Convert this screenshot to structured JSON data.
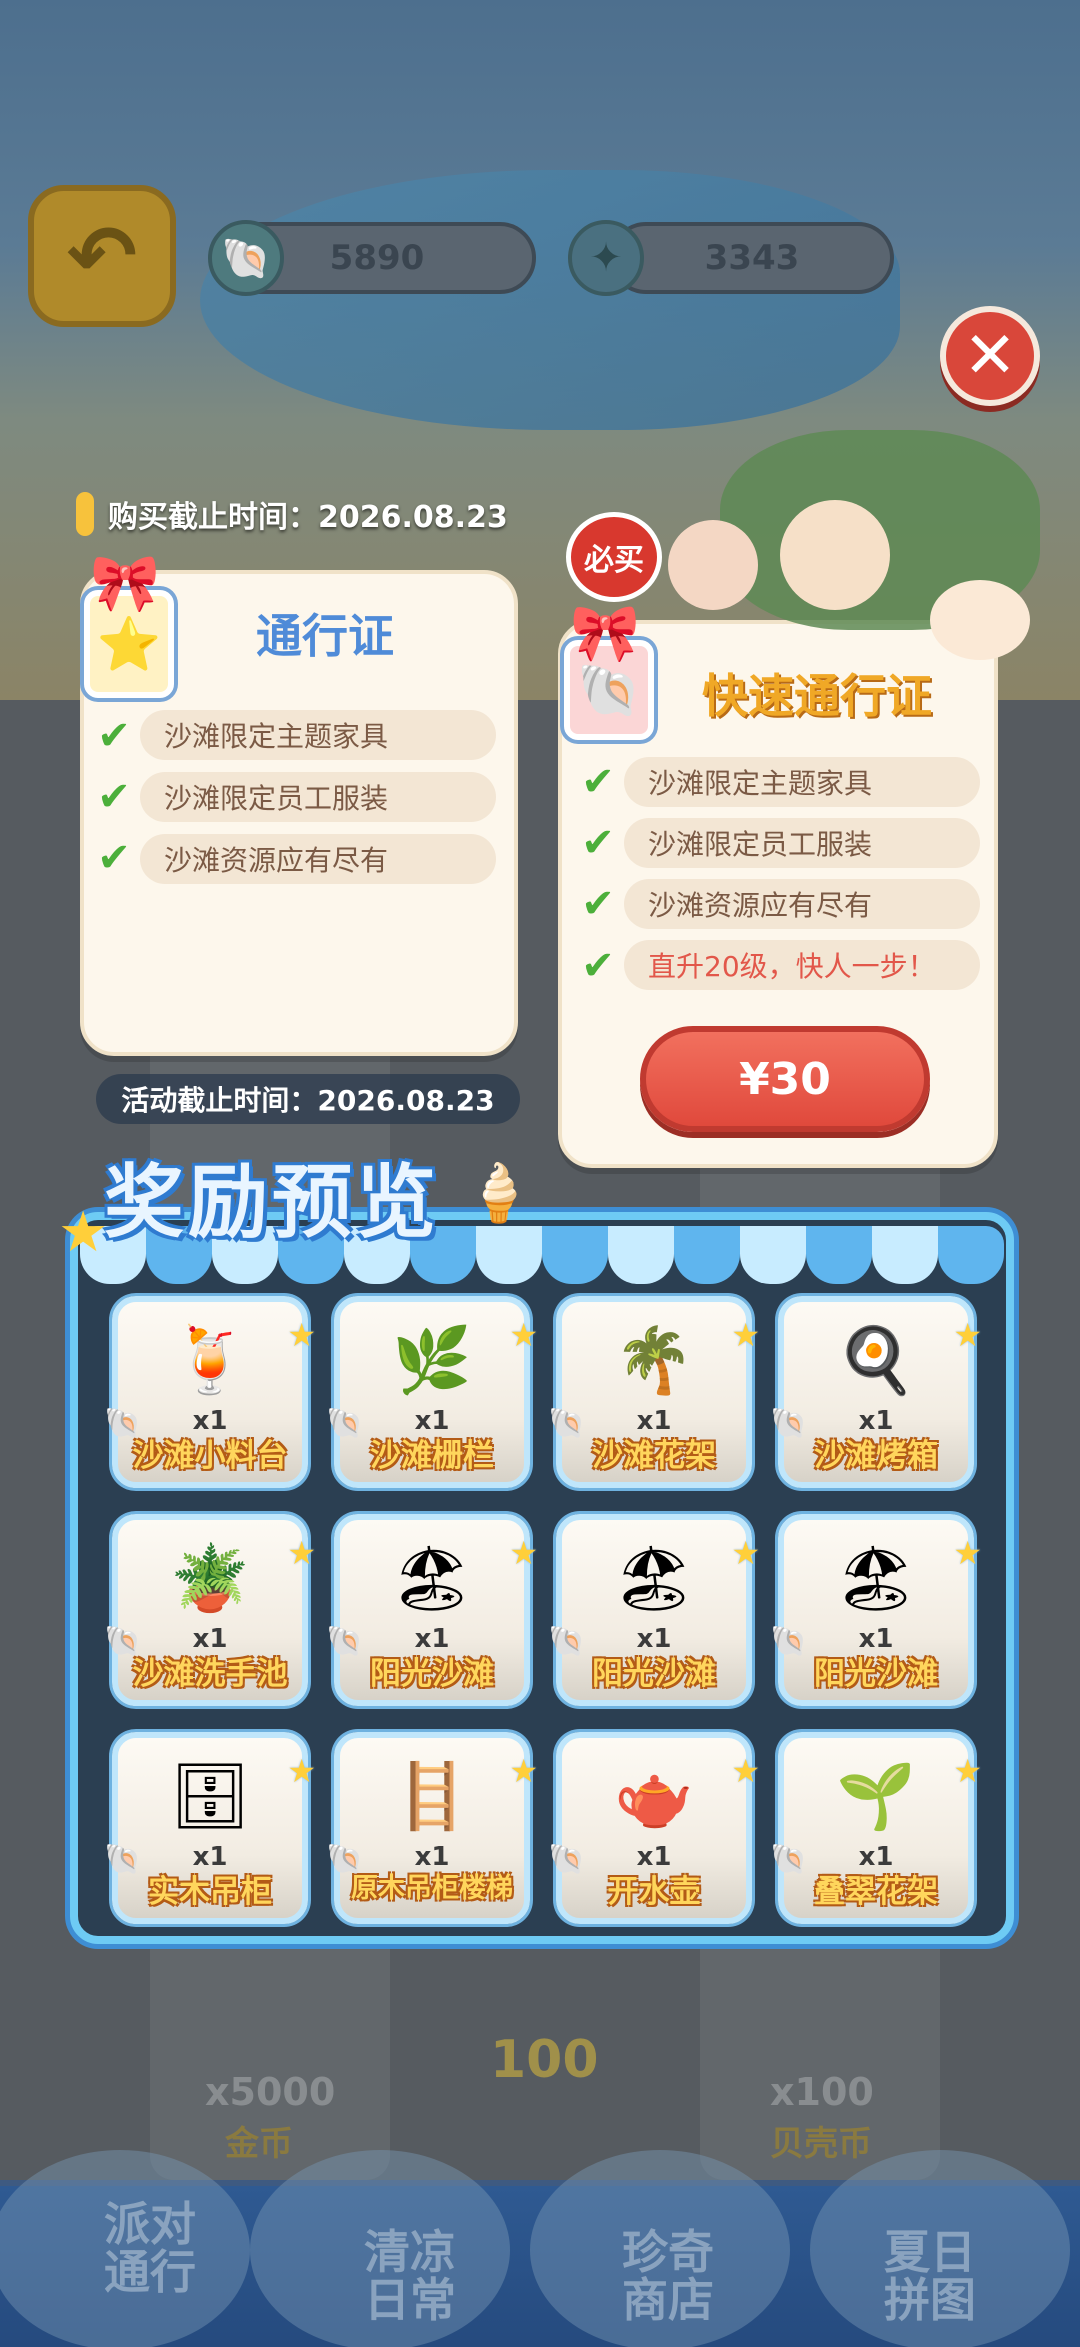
{
  "resources": {
    "shells": "5890",
    "stars": "3343"
  },
  "icons": {
    "back": "back-arrow-icon",
    "shell": "shell-icon",
    "star": "star-icon",
    "close": "close-icon",
    "check": "check-icon"
  },
  "purchase_deadline": "购买截止时间：2026.08.23",
  "activity_deadline": "活动截止时间：2026.08.23",
  "pass": {
    "title": "通行证",
    "features": [
      "沙滩限定主题家具",
      "沙滩限定员工服装",
      "沙滩资源应有尽有"
    ]
  },
  "fast_pass": {
    "title": "快速通行证",
    "badge": "必买",
    "features": [
      "沙滩限定主题家具",
      "沙滩限定员工服装",
      "沙滩资源应有尽有",
      "直升20级，快人一步！"
    ],
    "price": "¥30"
  },
  "reward_preview": {
    "title": "奖励预览",
    "items": [
      {
        "name": "沙滩小料台",
        "qty": "x1",
        "icon": "🍹"
      },
      {
        "name": "沙滩栅栏",
        "qty": "x1",
        "icon": "🌿"
      },
      {
        "name": "沙滩花架",
        "qty": "x1",
        "icon": "🌴"
      },
      {
        "name": "沙滩烤箱",
        "qty": "x1",
        "icon": "🍳"
      },
      {
        "name": "沙滩洗手池",
        "qty": "x1",
        "icon": "🪴"
      },
      {
        "name": "阳光沙滩",
        "qty": "x1",
        "icon": "🏖"
      },
      {
        "name": "阳光沙滩",
        "qty": "x1",
        "icon": "🏖"
      },
      {
        "name": "阳光沙滩",
        "qty": "x1",
        "icon": "🏖"
      },
      {
        "name": "实木吊柜",
        "qty": "x1",
        "icon": "🗄"
      },
      {
        "name": "原木吊柜楼梯",
        "qty": "x1",
        "icon": "🪜"
      },
      {
        "name": "开水壶",
        "qty": "x1",
        "icon": "🫖"
      },
      {
        "name": "叠翠花架",
        "qty": "x1",
        "icon": "🌱"
      }
    ]
  },
  "background": {
    "level_label": "100",
    "gold_label": "金币",
    "shell_coin_label": "贝壳币",
    "gold_amount": "x5000",
    "shell_amount": "x100"
  },
  "bottom_nav": [
    {
      "line1": "派对",
      "line2": "通行"
    },
    {
      "line1": "清凉",
      "line2": "日常"
    },
    {
      "line1": "珍奇",
      "line2": "商店"
    },
    {
      "line1": "夏日",
      "line2": "拼图"
    }
  ]
}
